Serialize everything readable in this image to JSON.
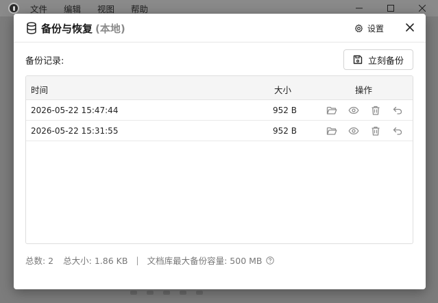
{
  "app": {
    "menu": [
      "文件",
      "编辑",
      "视图",
      "帮助"
    ],
    "window_controls": [
      "minimize-icon",
      "maximize-icon",
      "close-icon"
    ]
  },
  "dialog": {
    "title": "备份与恢复",
    "title_suffix": "(本地)",
    "settings_label": "设置",
    "records_label": "备份记录:",
    "backup_now_label": "立刻备份",
    "table": {
      "headers": {
        "time": "时间",
        "size": "大小",
        "actions": "操作"
      },
      "rows": [
        {
          "time": "2026-05-22 15:47:44",
          "size": "952 B"
        },
        {
          "time": "2026-05-22 15:31:55",
          "size": "952 B"
        }
      ],
      "row_actions": [
        "folder-open-icon",
        "eye-icon",
        "trash-icon",
        "undo-icon"
      ]
    },
    "footer": {
      "total_count": "总数:  2",
      "total_size": "总大小:  1.86 KB",
      "separator": "|",
      "capacity": "文档库最大备份容量:  500 MB"
    }
  },
  "colors": {
    "overlay_bg": "#7c7c7c",
    "dialog_bg": "#ffffff",
    "muted_text": "#8a8a8a",
    "header_bg": "#f5f5f5",
    "icon_gray": "#8c8c8c"
  }
}
